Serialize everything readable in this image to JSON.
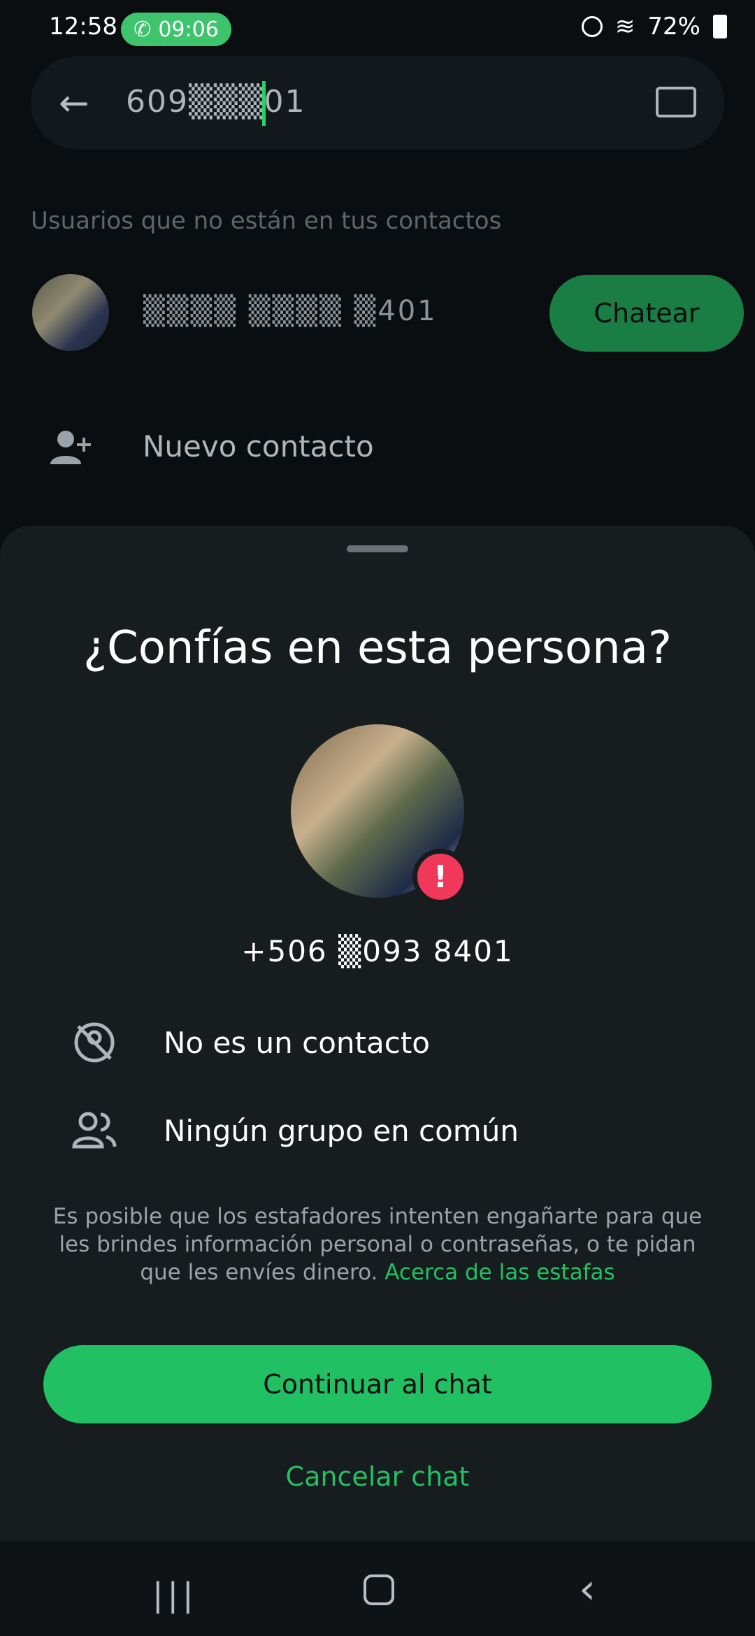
{
  "status_bar": {
    "time": "12:58",
    "call_timer": "09:06",
    "battery": "72%"
  },
  "search": {
    "query": "609▒▒▒01",
    "keyboard_icon": "keyboard-icon",
    "back_icon": "arrow-left-icon"
  },
  "results": {
    "section_label": "Usuarios que no están en tus contactos",
    "contact_number": "▒▒▒▒ ▒▒▒▒ ▒401",
    "chat_button": "Chatear",
    "new_contact": "Nuevo contacto"
  },
  "sheet": {
    "title": "¿Confías en esta persona?",
    "phone_number": "+506 ▒093 8401",
    "rows": [
      {
        "icon": "contact-off-icon",
        "label": "No es un contacto"
      },
      {
        "icon": "group-icon",
        "label": "Ningún grupo en común"
      }
    ],
    "warning": "Es posible que los estafadores intenten engañarte para que les brindes información personal o contraseñas, o te pidan que les envíes dinero.",
    "warning_link": "Acerca de las estafas",
    "continue_button": "Continuar al chat",
    "cancel_button": "Cancelar chat"
  },
  "colors": {
    "accent": "#21c063",
    "warning_badge": "#f0395a",
    "sheet_bg": "#171c1f"
  }
}
